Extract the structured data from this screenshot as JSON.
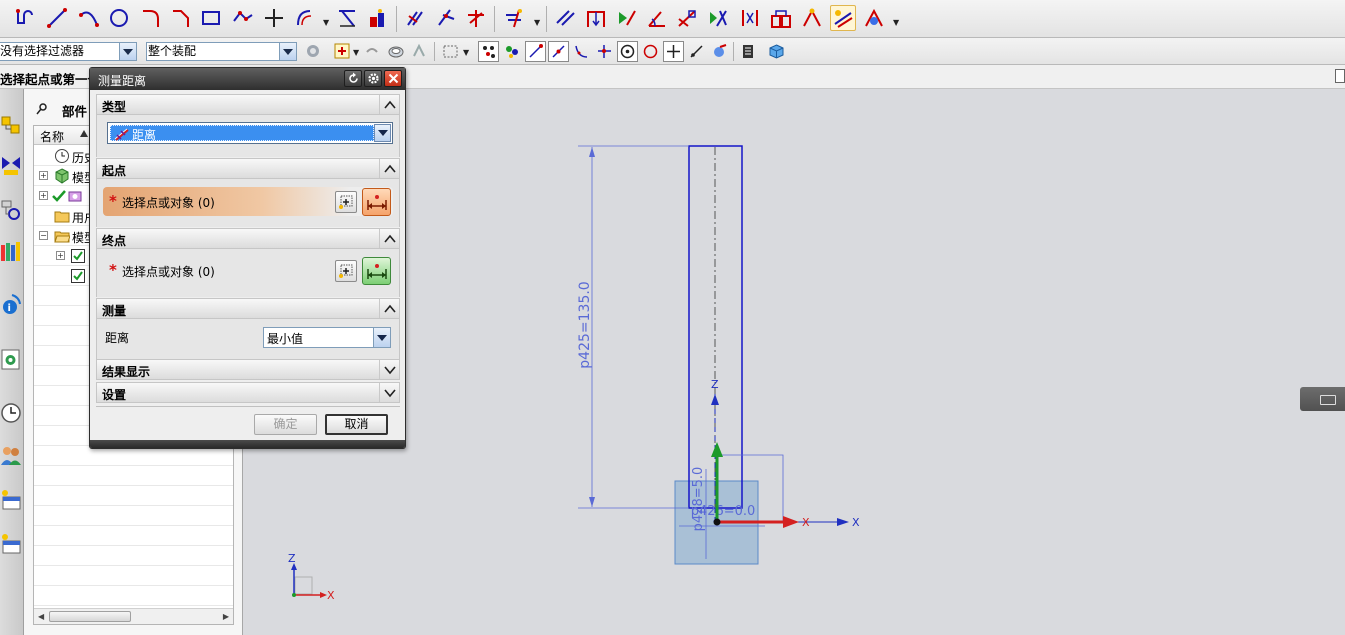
{
  "toolbar_sel": {
    "filter_value": "没有选择过滤器",
    "scope_value": "整个装配"
  },
  "cueline": {
    "text": "选择起点或第一个对象"
  },
  "navigator": {
    "title": "部件",
    "column_name": "名称",
    "rows": [
      {
        "label": "历史"
      },
      {
        "label": "模型"
      },
      {
        "label": ""
      },
      {
        "label": "用户"
      },
      {
        "label": "模型"
      },
      {
        "label": ""
      },
      {
        "label": ""
      }
    ]
  },
  "dialog": {
    "title": "测量距离",
    "groups": {
      "type": "类型",
      "start": "起点",
      "end": "终点",
      "measure": "测量",
      "result": "结果显示",
      "settings": "设置"
    },
    "type_value": "距离",
    "start_select": "选择点或对象 (0)",
    "end_select": "选择点或对象 (0)",
    "measure_label": "距离",
    "measure_value": "最小值",
    "ok_label": "确定",
    "cancel_label": "取消",
    "required_marker": "*"
  },
  "graphics": {
    "dim_main": "p425=135.0",
    "dim_small_v": "p428=5.0",
    "dim_small_h": "p426=0.0",
    "axis_x": "X",
    "axis_z": "Z",
    "colors": {
      "sketch_blue": "#1414c8",
      "dim_blue": "#5a6ad6",
      "axis_red": "#d42020",
      "axis_green": "#1c9a2a",
      "axis_blue": "#2030c0",
      "block_fill": "#a9c0d6"
    }
  }
}
